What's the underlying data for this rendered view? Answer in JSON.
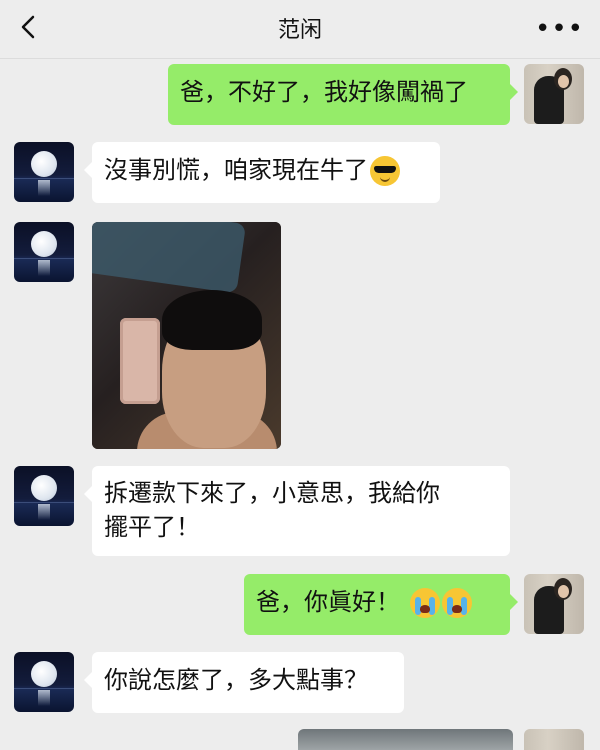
{
  "header": {
    "title": "范闲",
    "back_icon": "chevron-left-icon",
    "more_icon": "more-dots-icon",
    "more_glyph": "•••"
  },
  "messages": [
    {
      "side": "out",
      "text": "爸，不好了，我好像闖禍了"
    },
    {
      "side": "in",
      "text": "沒事別慌，咱家現在牛了",
      "emoji": "smiling-face-with-sunglasses"
    },
    {
      "side": "in",
      "type": "image",
      "image_desc": "selfie-with-cash"
    },
    {
      "side": "in",
      "lines": [
        "拆遷款下來了，小意思，我給你",
        "擺平了！"
      ]
    },
    {
      "side": "out",
      "text": "爸，你眞好！",
      "emoji": "loudly-crying-face x2"
    },
    {
      "side": "in",
      "text": "你說怎麼了，多大點事？"
    }
  ],
  "colors": {
    "background": "#ededed",
    "out_bubble": "#95ec69",
    "in_bubble": "#ffffff"
  }
}
